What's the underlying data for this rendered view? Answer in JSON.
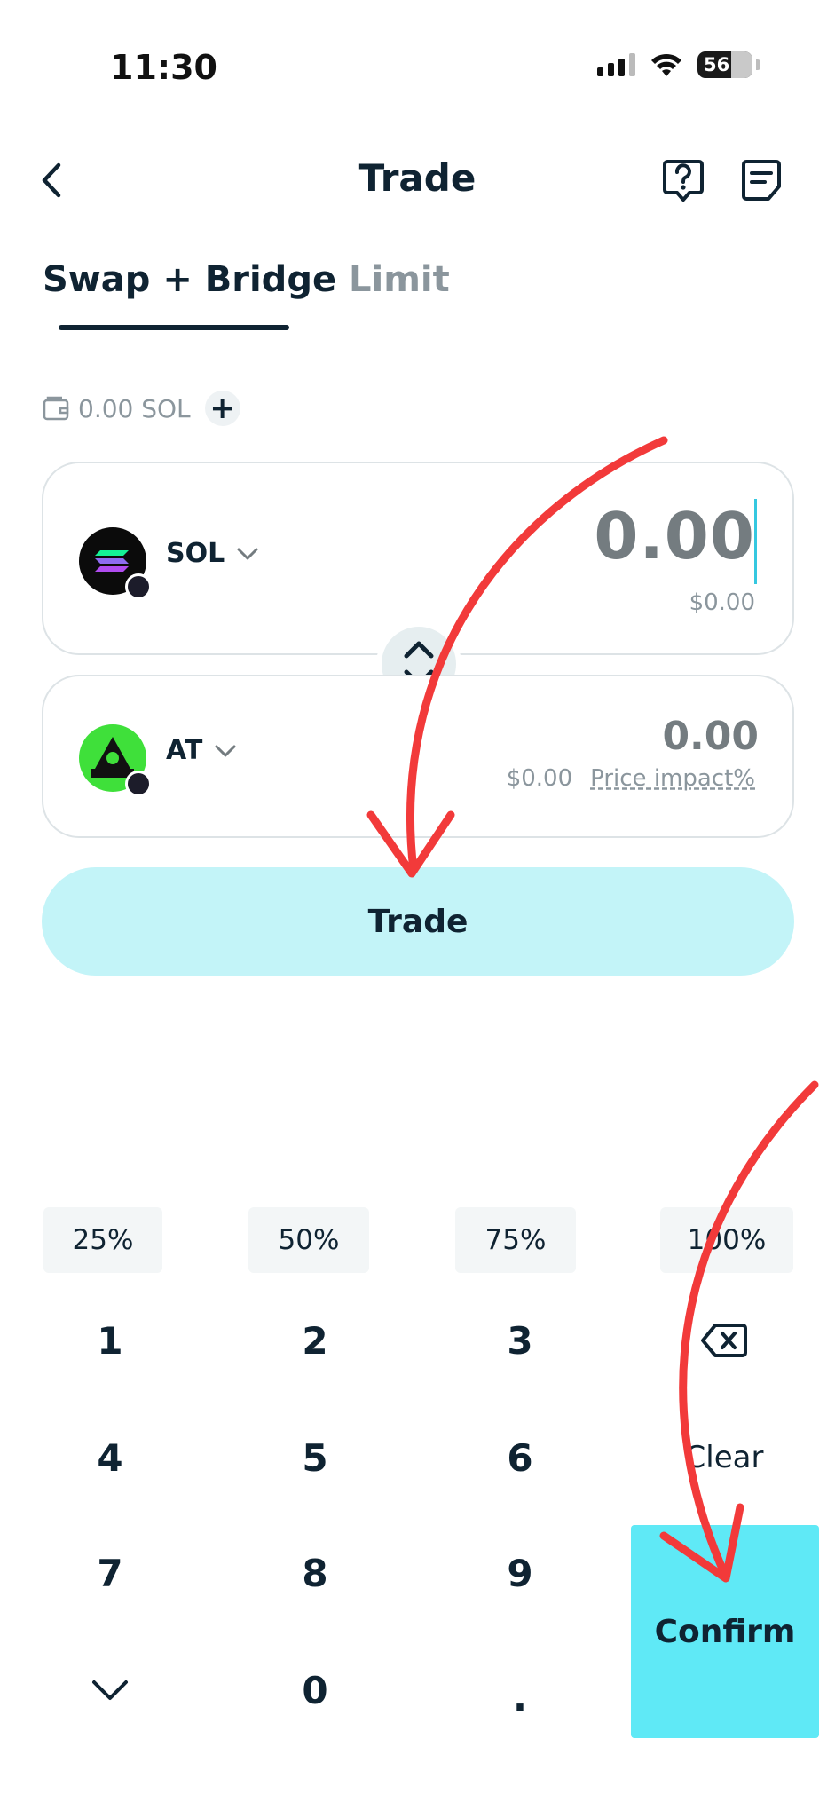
{
  "status_bar": {
    "time": "11:30",
    "battery": "56"
  },
  "header": {
    "title": "Trade"
  },
  "tabs": [
    {
      "label": "Swap + Bridge",
      "active": true
    },
    {
      "label": "Limit",
      "active": false
    }
  ],
  "balance": {
    "text": "0.00 SOL",
    "add_label": "+"
  },
  "from": {
    "token": "SOL",
    "amount": "0.00",
    "usd": "$0.00"
  },
  "to": {
    "token": "AT",
    "amount": "0.00",
    "usd": "$0.00",
    "price_impact": "Price impact%"
  },
  "trade_button": "Trade",
  "percent_buttons": [
    "25%",
    "50%",
    "75%",
    "100%"
  ],
  "keypad": {
    "keys": [
      "1",
      "2",
      "3",
      "4",
      "5",
      "6",
      "7",
      "8",
      "9",
      "0",
      "."
    ],
    "clear": "Clear",
    "confirm": "Confirm"
  },
  "colors": {
    "accent": "#5fe9f6",
    "trade_button_bg": "#c3f4f8",
    "annotation_arrow": "#f23a3a",
    "text_primary": "#0f2332",
    "text_muted": "#8b969d"
  }
}
